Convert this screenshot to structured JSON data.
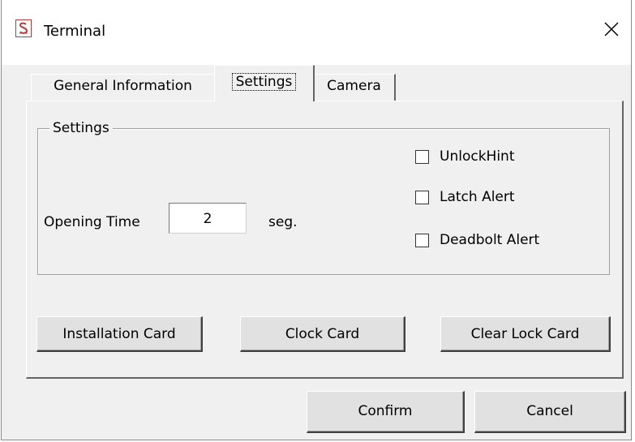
{
  "window": {
    "title": "Terminal",
    "app_icon": "app-logo-icon",
    "close_icon": "close-icon"
  },
  "tabs": [
    {
      "label": "General Information",
      "selected": false
    },
    {
      "label": "Settings",
      "selected": true
    },
    {
      "label": "Camera",
      "selected": false
    }
  ],
  "settings_group": {
    "legend": "Settings",
    "opening_time": {
      "label": "Opening Time",
      "value": "2",
      "unit": "seg."
    },
    "checkboxes": [
      {
        "label": "UnlockHint",
        "checked": false
      },
      {
        "label": "Latch Alert",
        "checked": false
      },
      {
        "label": "Deadbolt Alert",
        "checked": false
      }
    ]
  },
  "card_buttons": {
    "installation": "Installation Card",
    "clock": "Clock Card",
    "clear_lock": "Clear Lock Card"
  },
  "footer": {
    "confirm": "Confirm",
    "cancel": "Cancel"
  },
  "colors": {
    "app_icon_accent": "#b83a3a",
    "dialog_bg": "#f0f0f0",
    "titlebar_bg": "#ffffff"
  }
}
